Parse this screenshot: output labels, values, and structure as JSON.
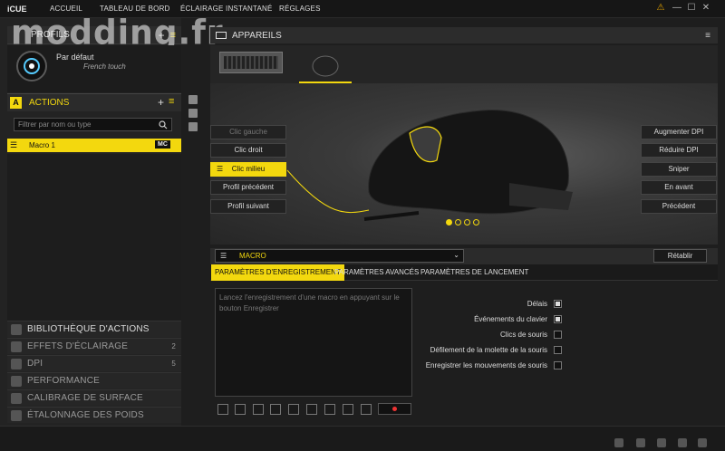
{
  "app": {
    "logo": "iCUE"
  },
  "nav": [
    "ACCUEIL",
    "TABLEAU DE BORD",
    "ÉCLAIRAGE INSTANTANÉ",
    "RÉGLAGES"
  ],
  "window_controls": [
    "⚠",
    "—",
    "☐",
    "✕"
  ],
  "watermark": "modding.fr",
  "profiles": {
    "title": "PROFILS",
    "add": "+",
    "menu": "≡",
    "profile_name": "Par défaut",
    "profile_sub": "French touch"
  },
  "actions": {
    "badge": "A",
    "title": "ACTIONS",
    "add": "+",
    "menu": "≡",
    "search_placeholder": "Filtrer par nom ou type",
    "items": [
      {
        "label": "Macro 1",
        "tag": "MC"
      }
    ]
  },
  "left_bottom": [
    {
      "label": "BIBLIOTHÈQUE D'ACTIONS",
      "count": ""
    },
    {
      "label": "EFFETS D'ÉCLAIRAGE",
      "count": "2"
    },
    {
      "label": "DPI",
      "count": "5"
    },
    {
      "label": "PERFORMANCE",
      "count": ""
    },
    {
      "label": "CALIBRAGE DE SURFACE",
      "count": ""
    },
    {
      "label": "ÉTALONNAGE DES POIDS",
      "count": ""
    }
  ],
  "devices": {
    "title": "APPAREILS",
    "menu": "≡"
  },
  "mouse_buttons_left": [
    {
      "label": "Clic gauche",
      "state": "dim"
    },
    {
      "label": "Clic droit",
      "state": "normal"
    },
    {
      "label": "Clic milieu",
      "state": "active"
    },
    {
      "label": "Profil précédent",
      "state": "normal"
    },
    {
      "label": "Profil suivant",
      "state": "normal"
    }
  ],
  "mouse_buttons_right": [
    "Augmenter DPI",
    "Réduire DPI",
    "Sniper",
    "En avant",
    "Précédent"
  ],
  "pager": {
    "active": 0,
    "count": 4
  },
  "macro": {
    "select_value": "MACRO",
    "reset_label": "Rétablir",
    "tabs": [
      {
        "label": "PARAMÈTRES D'ENREGISTREMENT",
        "active": true
      },
      {
        "label": "PARAMÈTRES AVANCÉS",
        "active": false
      },
      {
        "label": "PARAMÈTRES DE LANCEMENT",
        "active": false
      }
    ],
    "record_text": "Lancez l'enregistrement d'une macro en appuyant sur le bouton Enregistrer",
    "options": [
      {
        "label": "Délais",
        "checked": true
      },
      {
        "label": "Événements du clavier",
        "checked": true
      },
      {
        "label": "Clics de souris",
        "checked": false
      },
      {
        "label": "Défilement de la molette de la souris",
        "checked": false
      },
      {
        "label": "Enregistrer les mouvements de souris",
        "checked": false
      }
    ]
  },
  "colors": {
    "accent": "#f3d80e",
    "bg": "#1e1e1e"
  }
}
